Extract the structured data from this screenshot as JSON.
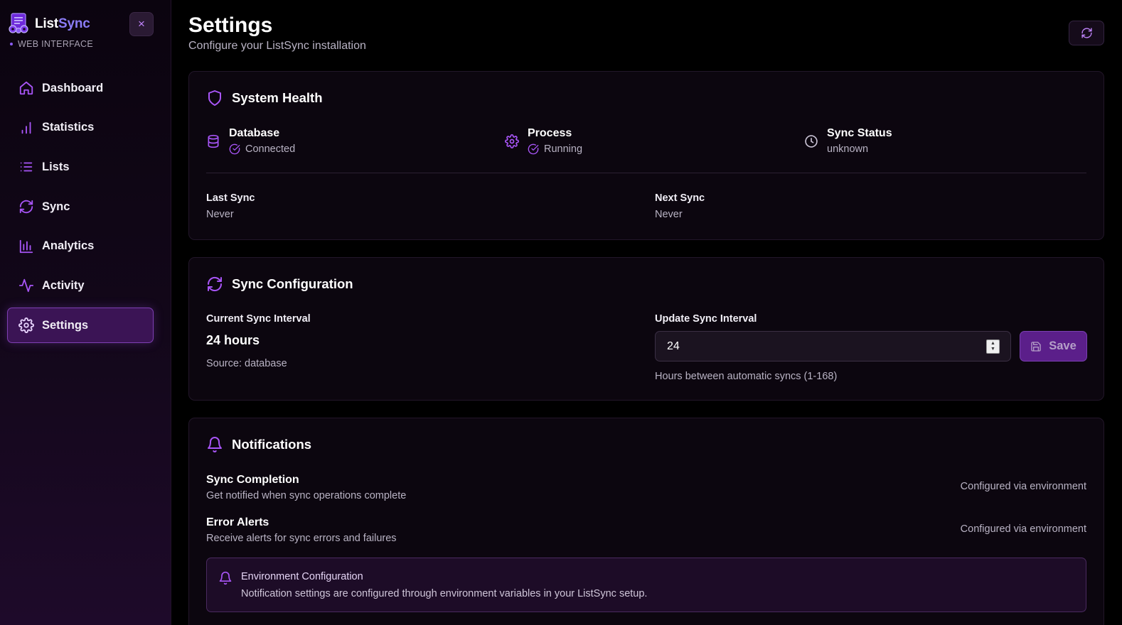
{
  "sidebar": {
    "brand": {
      "name_part1": "List",
      "name_part2": "Sync",
      "subtitle": "WEB INTERFACE"
    },
    "close_label": "×",
    "items": [
      {
        "label": "Dashboard",
        "icon": "home-icon",
        "active": false
      },
      {
        "label": "Statistics",
        "icon": "bar-chart-icon",
        "active": false
      },
      {
        "label": "Lists",
        "icon": "list-icon",
        "active": false
      },
      {
        "label": "Sync",
        "icon": "refresh-icon",
        "active": false
      },
      {
        "label": "Analytics",
        "icon": "analytics-chart-icon",
        "active": false
      },
      {
        "label": "Activity",
        "icon": "activity-icon",
        "active": false
      },
      {
        "label": "Settings",
        "icon": "gear-icon",
        "active": true
      }
    ]
  },
  "header": {
    "title": "Settings",
    "subtitle": "Configure your ListSync installation"
  },
  "system_health": {
    "title": "System Health",
    "items": [
      {
        "name": "Database",
        "status": "Connected",
        "icon": "database-icon",
        "check": true
      },
      {
        "name": "Process",
        "status": "Running",
        "icon": "gear-icon",
        "check": true
      },
      {
        "name": "Sync Status",
        "status": "unknown",
        "icon": "clock-icon",
        "check": false
      }
    ],
    "last_sync": {
      "label": "Last Sync",
      "value": "Never"
    },
    "next_sync": {
      "label": "Next Sync",
      "value": "Never"
    }
  },
  "sync_config": {
    "title": "Sync Configuration",
    "current_label": "Current Sync Interval",
    "current_value": "24 hours",
    "source": "Source: database",
    "update_label": "Update Sync Interval",
    "input_value": "24",
    "save_label": "Save",
    "hint": "Hours between automatic syncs (1-168)"
  },
  "notifications": {
    "title": "Notifications",
    "items": [
      {
        "title": "Sync Completion",
        "desc": "Get notified when sync operations complete",
        "config": "Configured via environment"
      },
      {
        "title": "Error Alerts",
        "desc": "Receive alerts for sync errors and failures",
        "config": "Configured via environment"
      }
    ],
    "env": {
      "title": "Environment Configuration",
      "desc": "Notification settings are configured through environment variables in your ListSync setup."
    }
  },
  "colors": {
    "accent": "#a855f7",
    "brand_secondary": "#8b7cf6",
    "active_nav_bg": "#3b1455",
    "save_bg": "#5b1f8a",
    "card_bg": "#0c060f",
    "page_bg": "#000000"
  }
}
